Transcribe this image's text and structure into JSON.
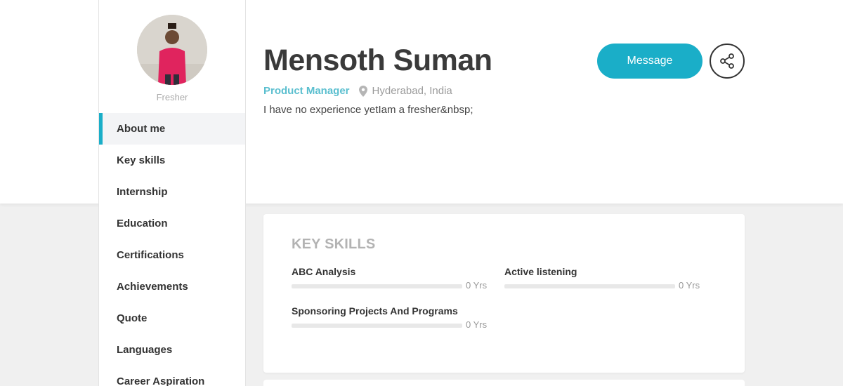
{
  "profile": {
    "name": "Mensoth Suman",
    "experience_label": "Fresher",
    "role": "Product Manager",
    "location": "Hyderabad, India",
    "about": "I have no experience yetIam a fresher&nbsp;",
    "message_label": "Message"
  },
  "sidebar": {
    "items": [
      {
        "label": "About me",
        "active": true
      },
      {
        "label": "Key skills"
      },
      {
        "label": "Internship"
      },
      {
        "label": "Education"
      },
      {
        "label": "Certifications"
      },
      {
        "label": "Achievements"
      },
      {
        "label": "Quote"
      },
      {
        "label": "Languages"
      },
      {
        "label": "Career Aspiration"
      }
    ]
  },
  "key_skills": {
    "title": "KEY SKILLS",
    "skills": [
      {
        "name": "ABC Analysis",
        "years": "0 Yrs",
        "level": 0
      },
      {
        "name": "Active listening",
        "years": "0 Yrs",
        "level": 0
      },
      {
        "name": "Sponsoring Projects And Programs",
        "years": "0 Yrs",
        "level": 0
      }
    ]
  },
  "colors": {
    "accent": "#1aaec8",
    "role_text": "#5bbfcf"
  },
  "icons": {
    "location": "map-pin-icon",
    "share": "share-icon"
  }
}
